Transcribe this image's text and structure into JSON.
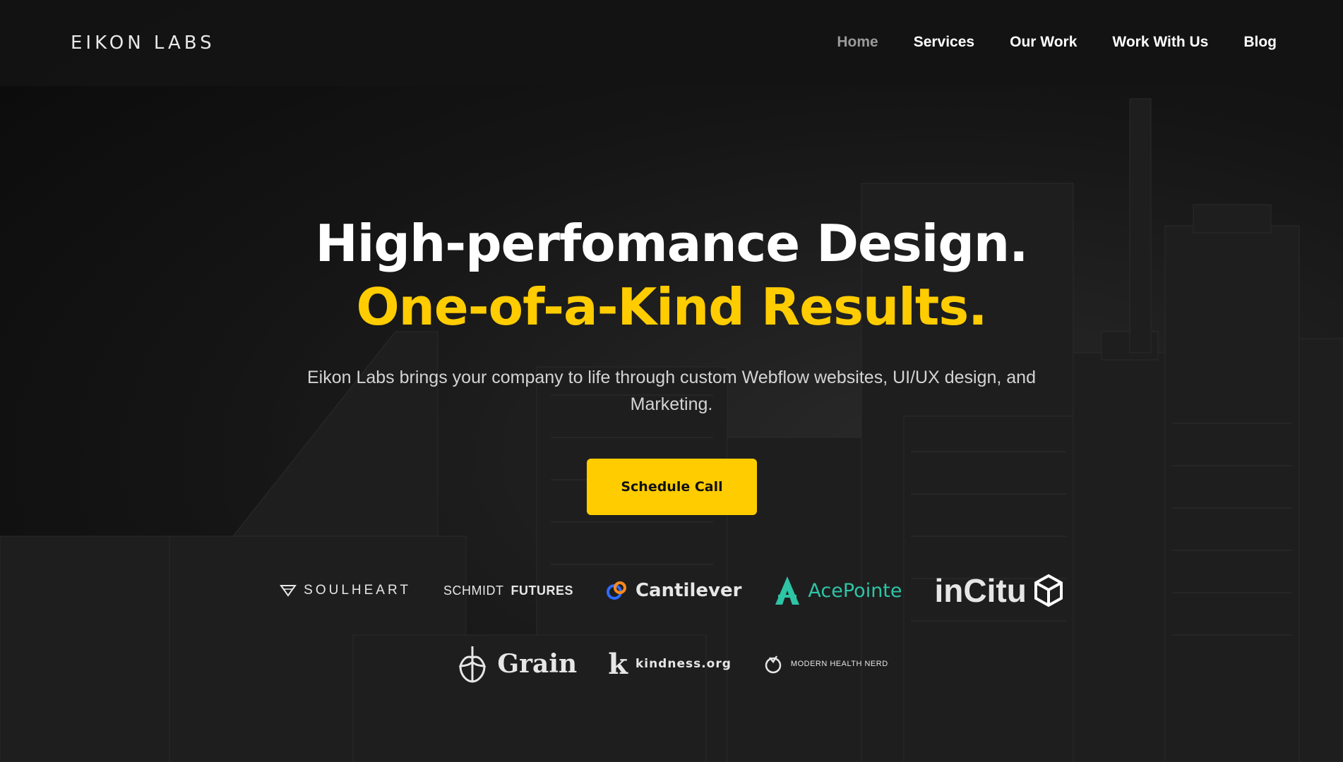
{
  "header": {
    "logo": "EIKON LABS",
    "nav": [
      {
        "label": "Home",
        "active": true
      },
      {
        "label": "Services"
      },
      {
        "label": "Our Work"
      },
      {
        "label": "Work With Us"
      },
      {
        "label": "Blog"
      }
    ]
  },
  "hero": {
    "title_line1": "High-perfomance Design.",
    "title_line2": "One-of-a-Kind Results.",
    "subtitle": "Eikon Labs brings your company to life through custom Webflow websites, UI/UX design, and Marketing.",
    "cta_label": "Schedule Call"
  },
  "clients": {
    "soulheart": "SOULHEART",
    "schmidt_a": "SCHMIDT",
    "schmidt_b": "FUTURES",
    "cantilever": "Cantilever",
    "acepointe": "AcePointe",
    "incitu": "inCitu",
    "grain": "Grain",
    "kindness_k": "k",
    "kindness": "kindness.org",
    "mhn": "MODERN HEALTH NERD"
  },
  "colors": {
    "accent": "#ffcc00",
    "background": "#0d0d0d",
    "acepointe": "#2ec4a6"
  }
}
